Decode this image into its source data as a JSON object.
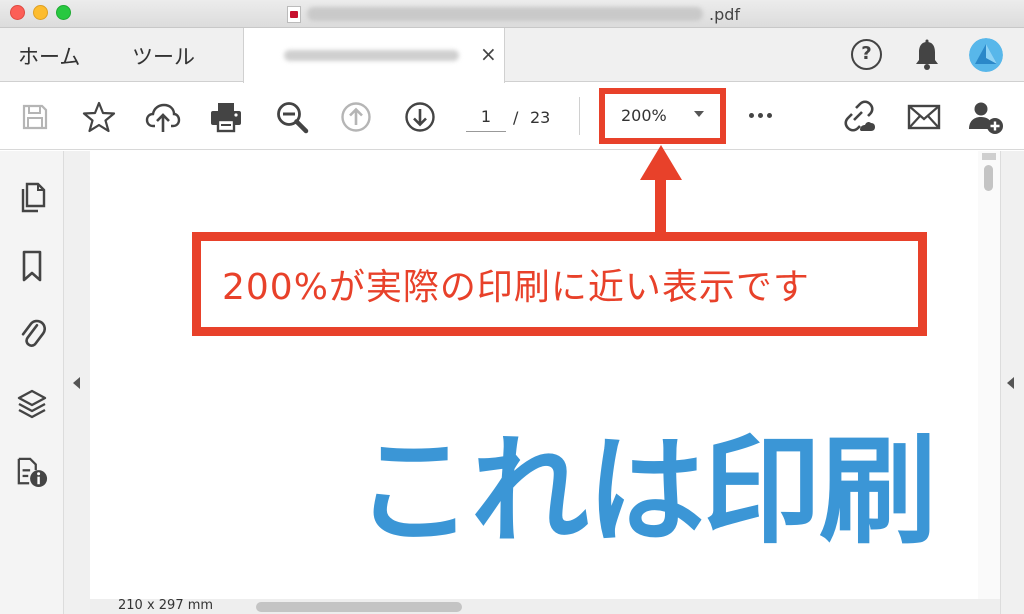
{
  "window": {
    "title_ext": ".pdf"
  },
  "tabs": {
    "home_label": "ホーム",
    "tools_label": "ツール",
    "close_glyph": "×"
  },
  "header": {
    "help_glyph": "?"
  },
  "toolbar": {
    "current_page": "1",
    "page_separator": "/",
    "total_pages": "23",
    "zoom_value": "200%"
  },
  "annotation": {
    "callout_text": "200%が実際の印刷に近い表示です"
  },
  "document": {
    "body_text": "これは印刷"
  },
  "status": {
    "page_size": "210 x 297 mm"
  },
  "colors": {
    "annotation_red": "#e8412a",
    "document_blue": "#3b96d6"
  },
  "icons": [
    "save-icon",
    "star-icon",
    "cloud-upload-icon",
    "print-icon",
    "zoom-out-icon",
    "page-up-icon",
    "page-down-icon",
    "more-icon",
    "share-link-icon",
    "mail-icon",
    "add-user-icon",
    "pages-icon",
    "bookmark-icon",
    "attachment-icon",
    "layers-icon",
    "document-info-icon",
    "bell-icon"
  ]
}
